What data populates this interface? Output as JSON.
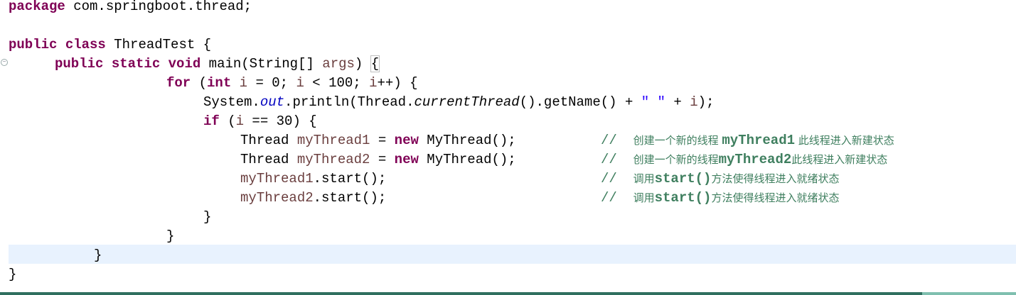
{
  "editor": {
    "lines": [
      [
        {
          "t": "package",
          "c": "kw"
        },
        {
          "t": " com.springboot.thread;",
          "c": ""
        }
      ],
      [],
      [
        {
          "t": "public",
          "c": "kw"
        },
        {
          "t": " ",
          "c": ""
        },
        {
          "t": "class",
          "c": "kw"
        },
        {
          "t": " ThreadTest {",
          "c": ""
        }
      ],
      [
        {
          "t": "public",
          "c": "kw"
        },
        {
          "t": " ",
          "c": ""
        },
        {
          "t": "static",
          "c": "kw"
        },
        {
          "t": " ",
          "c": ""
        },
        {
          "t": "void",
          "c": "kw"
        },
        {
          "t": " main(String[] ",
          "c": ""
        },
        {
          "t": "args",
          "c": "var"
        },
        {
          "t": ") ",
          "c": ""
        },
        {
          "t": "{",
          "c": "bracket"
        }
      ],
      [
        {
          "t": "for",
          "c": "kw"
        },
        {
          "t": " (",
          "c": ""
        },
        {
          "t": "int",
          "c": "kw"
        },
        {
          "t": " ",
          "c": ""
        },
        {
          "t": "i",
          "c": "var"
        },
        {
          "t": " = 0; ",
          "c": ""
        },
        {
          "t": "i",
          "c": "var"
        },
        {
          "t": " < 100; ",
          "c": ""
        },
        {
          "t": "i",
          "c": "var"
        },
        {
          "t": "++) {",
          "c": ""
        }
      ],
      [
        {
          "t": "System.",
          "c": ""
        },
        {
          "t": "out",
          "c": "fld"
        },
        {
          "t": ".println(Thread.",
          "c": ""
        },
        {
          "t": "currentThread",
          "c": "ital"
        },
        {
          "t": "().getName() + ",
          "c": ""
        },
        {
          "t": "\" \"",
          "c": "str"
        },
        {
          "t": " + ",
          "c": ""
        },
        {
          "t": "i",
          "c": "var"
        },
        {
          "t": ");",
          "c": ""
        }
      ],
      [
        {
          "t": "if",
          "c": "kw"
        },
        {
          "t": " (",
          "c": ""
        },
        {
          "t": "i",
          "c": "var"
        },
        {
          "t": " == 30) {",
          "c": ""
        }
      ],
      [
        {
          "t": "Thread ",
          "c": ""
        },
        {
          "t": "myThread1",
          "c": "var"
        },
        {
          "t": " = ",
          "c": ""
        },
        {
          "t": "new",
          "c": "kw"
        },
        {
          "t": " MyThread();",
          "c": ""
        }
      ],
      [
        {
          "t": "Thread ",
          "c": ""
        },
        {
          "t": "myThread2",
          "c": "var"
        },
        {
          "t": " = ",
          "c": ""
        },
        {
          "t": "new",
          "c": "kw"
        },
        {
          "t": " MyThread();",
          "c": ""
        }
      ],
      [
        {
          "t": "myThread1",
          "c": "var"
        },
        {
          "t": ".start();",
          "c": ""
        }
      ],
      [
        {
          "t": "myThread2",
          "c": "var"
        },
        {
          "t": ".start();",
          "c": ""
        }
      ],
      [
        {
          "t": "}",
          "c": ""
        }
      ],
      [
        {
          "t": "}",
          "c": ""
        }
      ],
      [
        {
          "t": "}",
          "c": ""
        }
      ],
      [
        {
          "t": "}",
          "c": ""
        }
      ]
    ],
    "comments": [
      null,
      null,
      null,
      null,
      null,
      null,
      null,
      [
        {
          "t": "//  ",
          "c": "cm"
        },
        {
          "t": "创建一个新的线程 ",
          "c": "cmzh"
        },
        {
          "t": "myThread1",
          "c": "cmb"
        },
        {
          "t": " 此线程进入新建状态",
          "c": "cmzh"
        }
      ],
      [
        {
          "t": "//  ",
          "c": "cm"
        },
        {
          "t": "创建一个新的线程",
          "c": "cmzh"
        },
        {
          "t": "myThread2",
          "c": "cmb"
        },
        {
          "t": "此线程进入新建状态",
          "c": "cmzh"
        }
      ],
      [
        {
          "t": "//  ",
          "c": "cm"
        },
        {
          "t": "调用",
          "c": "cmzh"
        },
        {
          "t": "start()",
          "c": "cmb"
        },
        {
          "t": "方法使得线程进入就绪状态",
          "c": "cmzh"
        }
      ],
      [
        {
          "t": "//  ",
          "c": "cm"
        },
        {
          "t": "调用",
          "c": "cmzh"
        },
        {
          "t": "start()",
          "c": "cmb"
        },
        {
          "t": "方法使得线程进入就绪状态",
          "c": "cmzh"
        }
      ],
      null,
      null,
      null,
      null
    ],
    "fold_icon": "collapse-icon",
    "current_line": 14
  }
}
